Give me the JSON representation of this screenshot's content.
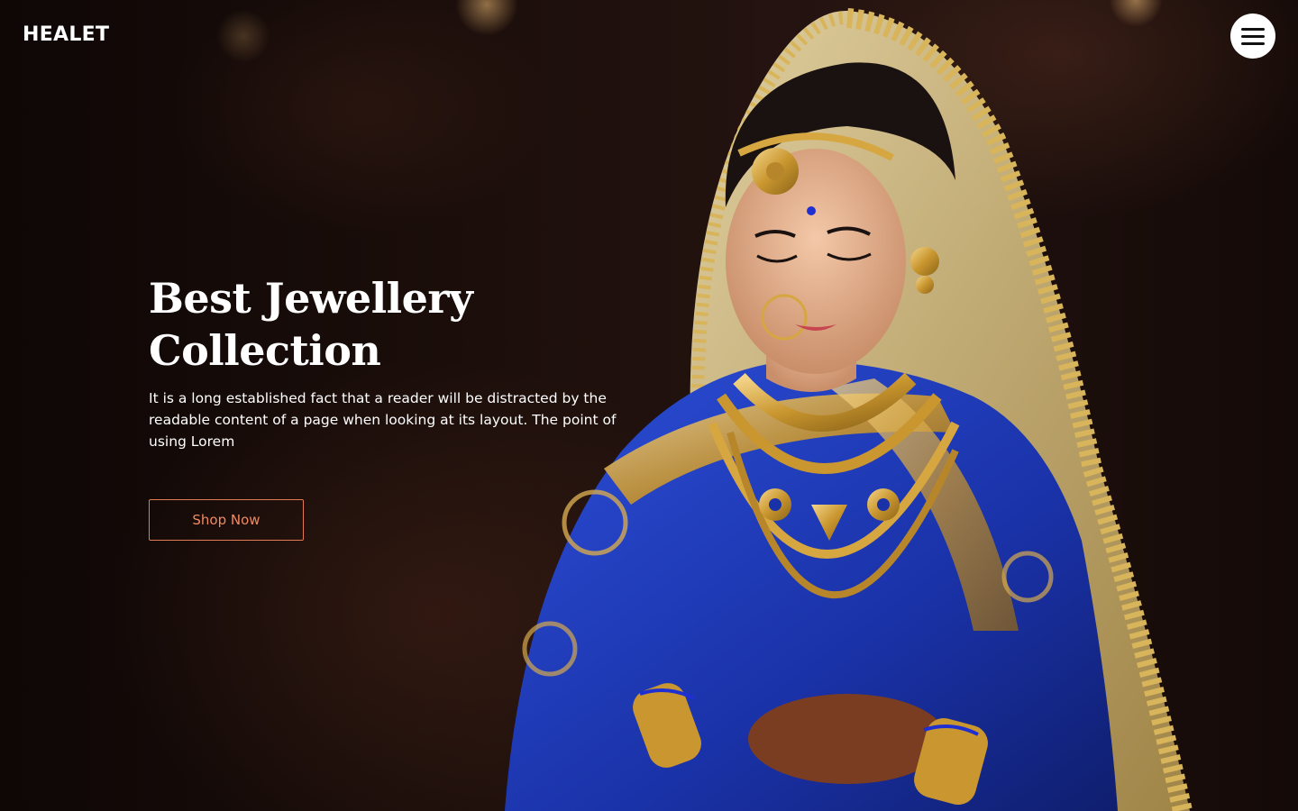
{
  "header": {
    "logo": "HEALET",
    "menu_icon": "hamburger-menu-icon"
  },
  "hero": {
    "title_line1": "Best Jewellery",
    "title_line2": "Collection",
    "description": "It is a long established fact that a reader will be distracted by the readable content of a page when looking at its layout. The point of using Lorem",
    "cta_label": "Shop Now"
  },
  "colors": {
    "cta_accent": "#f08a62",
    "background": "#1a0d08",
    "text": "#ffffff"
  }
}
